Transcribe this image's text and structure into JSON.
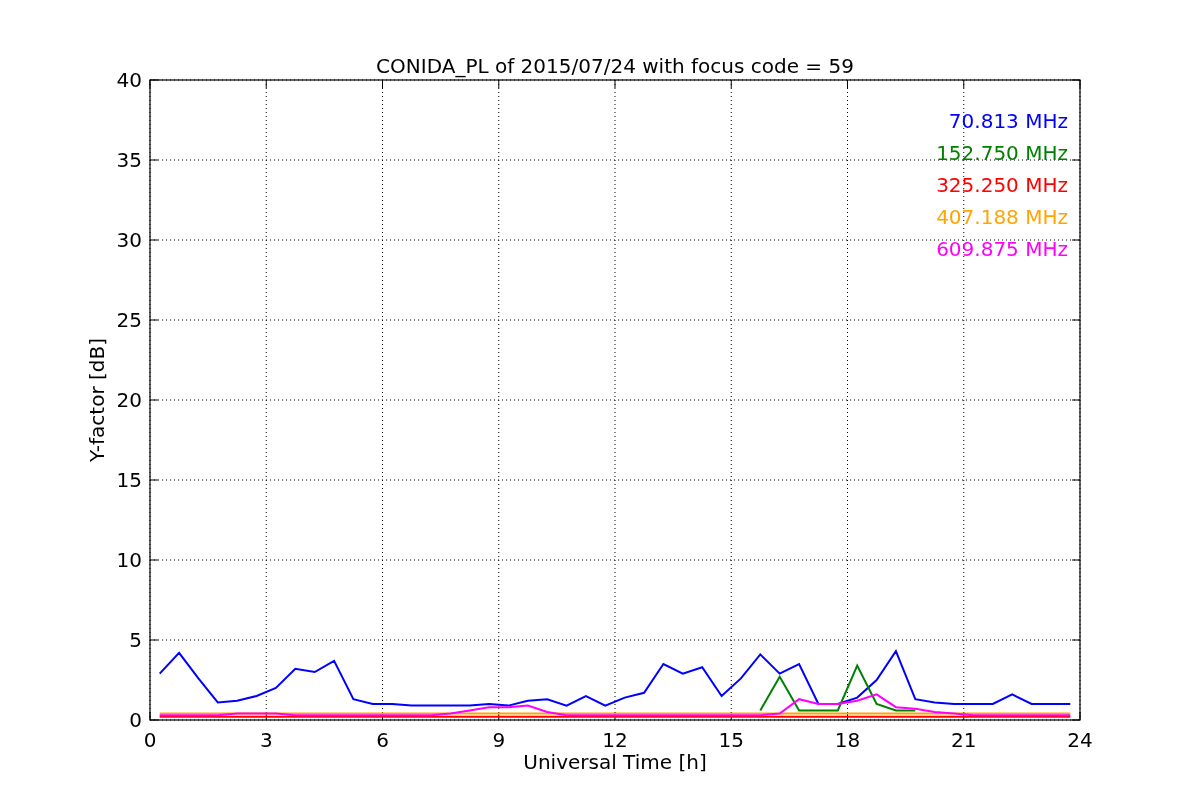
{
  "chart_data": {
    "type": "line",
    "title": "CONIDA_PL of 2015/07/24 with focus code = 59",
    "xlabel": "Universal Time [h]",
    "ylabel": "Y-factor [dB]",
    "x": [
      0.25,
      0.75,
      1.25,
      1.75,
      2.25,
      2.75,
      3.25,
      3.75,
      4.25,
      4.75,
      5.25,
      5.75,
      6.25,
      6.75,
      7.25,
      7.75,
      8.25,
      8.75,
      9.25,
      9.75,
      10.25,
      10.75,
      11.25,
      11.75,
      12.25,
      12.75,
      13.25,
      13.75,
      14.25,
      14.75,
      15.25,
      15.75,
      16.25,
      16.75,
      17.25,
      17.75,
      18.25,
      18.75,
      19.25,
      19.75,
      20.25,
      20.75,
      21.25,
      21.75,
      22.25,
      22.75,
      23.25,
      23.75
    ],
    "series": [
      {
        "name": "70.813 MHz",
        "color": "#0000ff",
        "values": [
          2.9,
          4.2,
          2.6,
          1.1,
          1.2,
          1.5,
          2.0,
          3.2,
          3.0,
          3.7,
          1.3,
          1.0,
          1.0,
          0.9,
          0.9,
          0.9,
          0.9,
          1.0,
          0.9,
          1.2,
          1.3,
          0.9,
          1.5,
          0.9,
          1.4,
          1.7,
          3.5,
          2.9,
          3.3,
          1.5,
          2.6,
          4.1,
          2.9,
          3.5,
          1.0,
          1.0,
          1.4,
          2.5,
          4.3,
          1.3,
          1.1,
          1.0,
          1.0,
          1.0,
          1.6,
          1.0,
          1.0,
          1.0
        ]
      },
      {
        "name": "152.750 MHz",
        "color": "#008000",
        "values": [
          null,
          null,
          null,
          null,
          null,
          null,
          null,
          null,
          null,
          null,
          null,
          null,
          null,
          null,
          null,
          null,
          null,
          null,
          null,
          null,
          null,
          null,
          null,
          null,
          null,
          null,
          null,
          null,
          null,
          null,
          null,
          0.6,
          2.7,
          0.6,
          0.6,
          0.6,
          3.4,
          1.0,
          0.6,
          0.6,
          null,
          null,
          null,
          null,
          null,
          null,
          null,
          null
        ]
      },
      {
        "name": "325.250 MHz",
        "color": "#ff0000",
        "values": [
          0.2,
          0.2,
          0.2,
          0.2,
          0.2,
          0.2,
          0.2,
          0.2,
          0.2,
          0.2,
          0.2,
          0.2,
          0.2,
          0.2,
          0.2,
          0.2,
          0.2,
          0.2,
          0.2,
          0.2,
          0.2,
          0.2,
          0.2,
          0.2,
          0.2,
          0.2,
          0.2,
          0.2,
          0.2,
          0.2,
          0.2,
          0.2,
          0.2,
          0.2,
          0.2,
          0.2,
          0.2,
          0.2,
          0.2,
          0.2,
          0.2,
          0.2,
          0.2,
          0.2,
          0.2,
          0.2,
          0.2,
          0.2
        ]
      },
      {
        "name": "407.188 MHz",
        "color": "#ffa500",
        "values": [
          0.4,
          0.4,
          0.4,
          0.4,
          0.4,
          0.4,
          0.4,
          0.4,
          0.4,
          0.4,
          0.4,
          0.4,
          0.4,
          0.4,
          0.4,
          0.4,
          0.4,
          0.4,
          0.4,
          0.4,
          0.4,
          0.4,
          0.4,
          0.4,
          0.4,
          0.4,
          0.4,
          0.4,
          0.4,
          0.4,
          0.4,
          0.4,
          0.4,
          0.4,
          0.4,
          0.4,
          0.4,
          0.4,
          0.4,
          0.4,
          0.4,
          0.4,
          0.4,
          0.4,
          0.4,
          0.4,
          0.4,
          0.4
        ]
      },
      {
        "name": "609.875 MHz",
        "color": "#ff00ff",
        "values": [
          0.3,
          0.3,
          0.3,
          0.3,
          0.4,
          0.4,
          0.4,
          0.3,
          0.3,
          0.3,
          0.3,
          0.3,
          0.3,
          0.3,
          0.3,
          0.4,
          0.6,
          0.8,
          0.8,
          0.9,
          0.5,
          0.3,
          0.3,
          0.3,
          0.3,
          0.3,
          0.3,
          0.3,
          0.3,
          0.3,
          0.3,
          0.3,
          0.4,
          1.3,
          1.0,
          1.0,
          1.2,
          1.6,
          0.8,
          0.7,
          0.5,
          0.4,
          0.3,
          0.3,
          0.3,
          0.3,
          0.3,
          0.3
        ]
      }
    ],
    "grid": true,
    "xlim": [
      0,
      24
    ],
    "ylim": [
      0,
      40
    ],
    "xticks": [
      0,
      3,
      6,
      9,
      12,
      15,
      18,
      21,
      24
    ],
    "yticks": [
      0,
      5,
      10,
      15,
      20,
      25,
      30,
      35,
      40
    ]
  }
}
